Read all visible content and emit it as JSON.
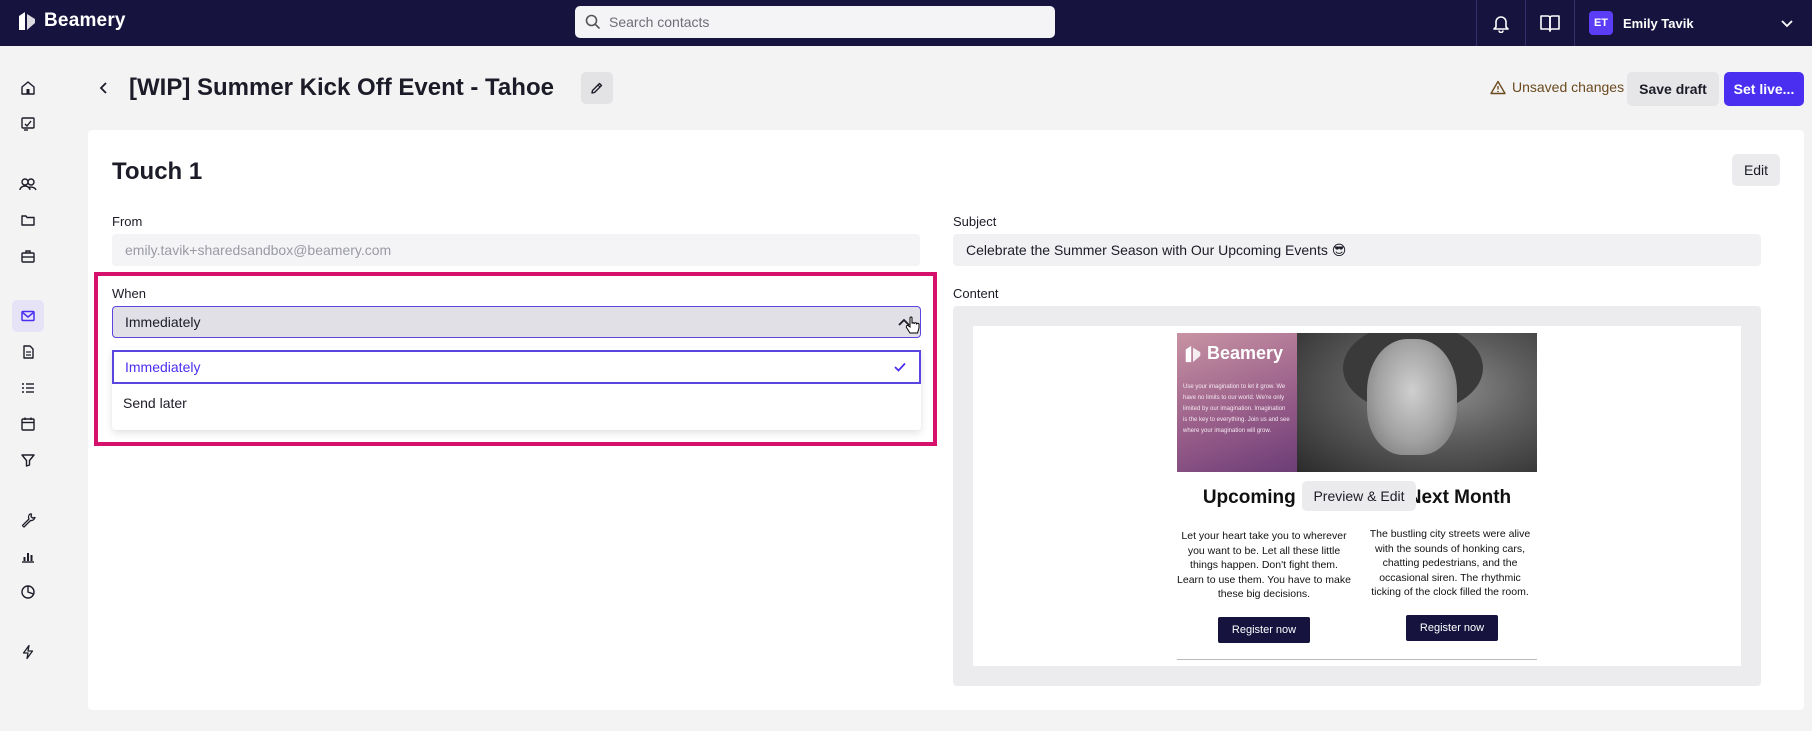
{
  "topbar": {
    "brand": "Beamery",
    "search_placeholder": "Search contacts",
    "user_initials": "ET",
    "user_name": "Emily Tavik"
  },
  "header": {
    "title": "[WIP] Summer Kick Off Event - Tahoe",
    "unsaved_text": "Unsaved changes",
    "save_draft_label": "Save draft",
    "set_live_label": "Set live..."
  },
  "touch": {
    "title": "Touch 1",
    "edit_label": "Edit",
    "from_label": "From",
    "from_value": "emily.tavik+sharedsandbox@beamery.com",
    "subject_label": "Subject",
    "subject_value": "Celebrate the Summer Season with Our Upcoming Events 😎",
    "when_label": "When",
    "when_value": "Immediately",
    "when_options": [
      "Immediately",
      "Send later"
    ],
    "content_label": "Content"
  },
  "email_preview": {
    "brand": "Beamery",
    "hero_copy": "Use your imagination to let it grow. We have no limits to our world. We're only limited by our imagination. Imagination is the key to everything. Join us and see where your imagination will grow.",
    "heading_left": "Upcoming",
    "heading_right": "Next Month",
    "preview_label": "Preview & Edit",
    "col1_text": "Let your heart take you to wherever you want to be. Let all these little things happen. Don't fight them. Learn to use them. You have to make these big decisions.",
    "col2_text": "The bustling city streets were alive with the sounds of honking cars, chatting pedestrians, and the occasional siren. The rhythmic ticking of the clock filled the room.",
    "register_label": "Register now"
  },
  "colors": {
    "topbar": "#16133e",
    "accent": "#4a2ff0",
    "highlight": "#d6116b"
  }
}
